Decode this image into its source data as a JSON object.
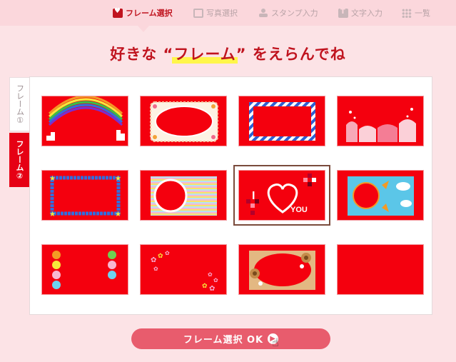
{
  "nav": {
    "items": [
      {
        "label": "フレーム選択",
        "icon": "heart-icon",
        "active": true
      },
      {
        "label": "写真選択",
        "icon": "photo-icon"
      },
      {
        "label": "スタンプ入力",
        "icon": "stamp-icon"
      },
      {
        "label": "文字入力",
        "icon": "text-icon"
      },
      {
        "label": "一覧",
        "icon": "grid-icon"
      }
    ]
  },
  "heading": {
    "prefix": "好きな “",
    "highlight": "フレーム",
    "suffix": "” をえらんでね"
  },
  "tabs": [
    {
      "label": "フレーム①",
      "active": false
    },
    {
      "label": "フレーム②",
      "active": true
    }
  ],
  "frames": [
    {
      "id": "rainbow",
      "icon": "rainbow-frame-icon"
    },
    {
      "id": "lace-oval",
      "icon": "lace-oval-frame-icon"
    },
    {
      "id": "airmail",
      "icon": "airmail-frame-icon"
    },
    {
      "id": "hearts-bottom",
      "icon": "hearts-frame-icon"
    },
    {
      "id": "stars-border",
      "icon": "star-border-frame-icon"
    },
    {
      "id": "stripes-circle",
      "icon": "striped-circle-frame-icon"
    },
    {
      "id": "i-love-you",
      "icon": "i-love-you-frame-icon",
      "selected": true,
      "text_i": "I",
      "text_you": "YOU"
    },
    {
      "id": "sun-sky",
      "icon": "sun-frame-icon"
    },
    {
      "id": "balloons",
      "icon": "balloons-frame-icon"
    },
    {
      "id": "flowers-corner",
      "icon": "flower-corner-frame-icon"
    },
    {
      "id": "flowers-oval",
      "icon": "flower-oval-frame-icon"
    },
    {
      "id": "plain",
      "icon": "plain-frame-icon"
    }
  ],
  "ok_button": {
    "label": "フレーム選択 OK",
    "icon": "arrow-right-icon",
    "cursor_icon": "hand-pointer-icon"
  },
  "colors": {
    "accent": "#c0141f",
    "frame_red": "#f4000e",
    "button": "#e85c6d",
    "bg": "#fce3e6"
  }
}
